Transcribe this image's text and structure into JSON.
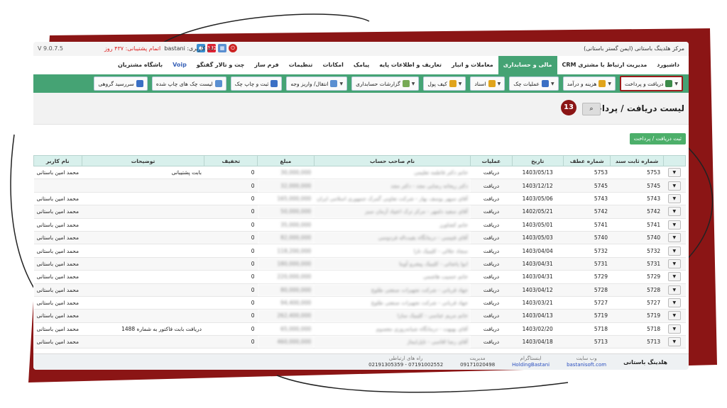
{
  "topbar": {
    "company": "مرکز هلدینگ باستانی (ایمن گستر باستانی)",
    "user_label": "نام کاربری: bastani",
    "support_label": "اتمام پشتیبانی:",
    "support_days": "۴۳۷ روز",
    "version": "V 9.0.7.5",
    "notif_count": "132"
  },
  "menu": [
    {
      "label": "داشبورد"
    },
    {
      "label": "مدیریت ارتباط با مشتری CRM"
    },
    {
      "label": "مالی و حسابداری"
    },
    {
      "label": "معاملات و انبار"
    },
    {
      "label": "تعاریف و اطلاعات پایه"
    },
    {
      "label": "پیامک"
    },
    {
      "label": "امکانات"
    },
    {
      "label": "تنظیمات"
    },
    {
      "label": "فرم ساز"
    },
    {
      "label": "چت و تالار گفتگو"
    },
    {
      "label": "Voip"
    },
    {
      "label": "باشگاه مشتریان"
    }
  ],
  "toolbar": [
    {
      "label": "دریافت و پرداخت",
      "icon": "receive-pay-icon",
      "color": "#3c8b4a"
    },
    {
      "label": "هزینه و درآمد",
      "icon": "coins-icon",
      "color": "#e0a41c"
    },
    {
      "label": "عملیات چک",
      "icon": "check-icon",
      "color": "#3a6fc4"
    },
    {
      "label": "اسناد",
      "icon": "docs-icon",
      "color": "#e0a41c"
    },
    {
      "label": "کیف پول",
      "icon": "wallet-icon",
      "color": "#e0a41c"
    },
    {
      "label": "گزارشات حسابداری",
      "icon": "report-icon",
      "color": "#7a5"
    },
    {
      "label": "انتقال/ واریز وجه",
      "icon": "transfer-icon",
      "color": "#5a8fd1"
    },
    {
      "label": "ثبت و چاپ چک",
      "icon": "print-check-icon",
      "color": "#3a6fc4"
    },
    {
      "label": "لیست چک های چاپ شده",
      "icon": "list-icon",
      "color": "#5a8fd1"
    },
    {
      "label": "سررسید گروهی",
      "icon": "calendar-icon",
      "color": "#3a6fc4"
    }
  ],
  "page": {
    "title": "لیست دریافت / پرداخت",
    "badge": "13",
    "new_button": "ثبت دریافت / پرداخت"
  },
  "table": {
    "headers": [
      "شماره ثابت سند",
      "شماره عطف",
      "تاریخ",
      "عملیات",
      "نام صاحب حساب",
      "مبلغ",
      "تخفیف",
      "توضیحات",
      "نام کاربر"
    ],
    "rows": [
      {
        "doc": "5753",
        "ref": "5753",
        "date": "1403/05/13",
        "op": "دریافت",
        "name": "خانم دکتر فاطمه تعلیمی",
        "amount": "30,000,000",
        "disc": "0",
        "desc": "بابت پشتیبانی",
        "user": "محمد امین باستانی"
      },
      {
        "doc": "5745",
        "ref": "5745",
        "date": "1403/12/12",
        "op": "دریافت",
        "name": "دکتر ریحانه رضایی مجد - دکتر مجد",
        "amount": "32,000,000",
        "disc": "0",
        "desc": "",
        "user": ""
      },
      {
        "doc": "5743",
        "ref": "5743",
        "date": "1403/05/06",
        "op": "دریافت",
        "name": "آقای سپهر یوسف بهار - شرکت تعاونی گمرک جمهوری اسلامی ایران",
        "amount": "165,000,000",
        "disc": "0",
        "desc": "",
        "user": "محمد امین باستانی"
      },
      {
        "doc": "5742",
        "ref": "5742",
        "date": "1402/05/21",
        "op": "دریافت",
        "name": "آقای سعید دلمهر - مرکز ترک اعتیاد آزمان سبز",
        "amount": "50,000,000",
        "disc": "0",
        "desc": "",
        "user": "محمد امین باستانی"
      },
      {
        "doc": "5741",
        "ref": "5741",
        "date": "1403/05/01",
        "op": "دریافت",
        "name": "خانم کشاورز",
        "amount": "35,000,000",
        "disc": "0",
        "desc": "",
        "user": "محمد امین باستانی"
      },
      {
        "doc": "5740",
        "ref": "5740",
        "date": "1403/05/03",
        "op": "دریافت",
        "name": "آقای فتیسی - درمانگاه بقیت‌اله فردوسی",
        "amount": "82,000,000",
        "disc": "0",
        "desc": "",
        "user": "محمد امین باستانی"
      },
      {
        "doc": "5732",
        "ref": "5732",
        "date": "1403/04/04",
        "op": "دریافت",
        "name": "سجاد جلالی - کلینیک تارا",
        "amount": "118,200,000",
        "disc": "0",
        "desc": "",
        "user": "محمد امین باستانی"
      },
      {
        "doc": "5731",
        "ref": "5731",
        "date": "1403/04/31",
        "op": "دریافت",
        "name": "ابوا پاشائی - کلینیک پیشرو آوینا",
        "amount": "180,000,000",
        "disc": "0",
        "desc": "",
        "user": "محمد امین باستانی"
      },
      {
        "doc": "5729",
        "ref": "5729",
        "date": "1403/04/31",
        "op": "دریافت",
        "name": "خانم حسیب هاشمی",
        "amount": "220,000,000",
        "disc": "0",
        "desc": "",
        "user": "محمد امین باستانی"
      },
      {
        "doc": "5728",
        "ref": "5728",
        "date": "1403/04/12",
        "op": "دریافت",
        "name": "جهاد قربانی - شرکت تجهیزات صنعتی طلوع",
        "amount": "80,000,000",
        "disc": "0",
        "desc": "",
        "user": "محمد امین باستانی"
      },
      {
        "doc": "5727",
        "ref": "5727",
        "date": "1403/03/21",
        "op": "دریافت",
        "name": "جهاد قربانی - شرکت تجهیزات صنعتی طلوع",
        "amount": "94,400,000",
        "disc": "0",
        "desc": "",
        "user": "محمد امین باستانی"
      },
      {
        "doc": "5719",
        "ref": "5719",
        "date": "1403/04/13",
        "op": "دریافت",
        "name": "خانم مریم عباسی - کلینیک سارا",
        "amount": "262,400,000",
        "disc": "0",
        "desc": "",
        "user": "محمد امین باستانی"
      },
      {
        "doc": "5718",
        "ref": "5718",
        "date": "1403/02/20",
        "op": "دریافت",
        "name": "آقای بهبهت - درمانگاه شبانه‌روزی معصوم",
        "amount": "65,000,000",
        "disc": "0",
        "desc": "دریافت بابت فاکتور به شماره 1488",
        "user": "محمد امین باستانی"
      },
      {
        "doc": "5713",
        "ref": "5713",
        "date": "1403/04/18",
        "op": "دریافت",
        "name": "آقای رضا اقاسی - تاپل‌ایماژ",
        "amount": "460,000,000",
        "disc": "0",
        "desc": "",
        "user": "محمد امین باستانی"
      }
    ]
  },
  "footer": {
    "brand": "هلدینگ باستانی",
    "website_label": "وب سایت",
    "website": "bastanisoft.com",
    "instagram_label": "اینستاگرام",
    "instagram": "HoldingBastani",
    "manager_label": "مدیریت",
    "manager": "09171020498",
    "contact_label": "راه های ارتباطی",
    "contact": "07191002552 - 02191305359"
  }
}
